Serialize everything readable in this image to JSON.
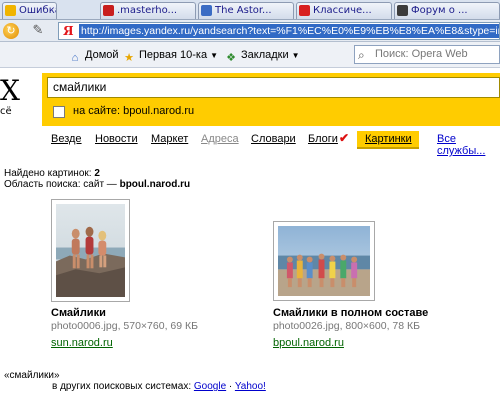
{
  "tabs": [
    {
      "label": "Ошибка",
      "icon": "warning-icon",
      "color": "#e8a600"
    },
    {
      "label": ".masterho...",
      "icon": "m-site-icon",
      "color": "#c81e1e"
    },
    {
      "label": "The Astor...",
      "icon": "page-icon",
      "color": "#3b6cc4"
    },
    {
      "label": "Классиче...",
      "icon": "star-site-icon",
      "color": "#d82020"
    },
    {
      "label": "Форум о ...",
      "icon": "forum-icon",
      "color": "#3c3c3c"
    }
  ],
  "address": {
    "logo": "Я",
    "url": "http://images.yandex.ru/yandsearch?text=%F1%EC%E0%E9%EB%E8%EA%E8&stype=image"
  },
  "bookmarks": [
    {
      "label": "Домой",
      "icon": "home-icon"
    },
    {
      "label": "Первая 10-ка",
      "icon": "star-icon",
      "has_dropdown": true
    },
    {
      "label": "Закладки",
      "icon": "bookmarks-icon",
      "has_dropdown": true
    }
  ],
  "opera_search": {
    "placeholder": "Поиск: Opera Web"
  },
  "logo": {
    "letter": "X",
    "sub": "сё"
  },
  "search": {
    "query": "смайлики",
    "site_label": "на сайте: bpoul.narod.ru"
  },
  "services": {
    "items": [
      "Везде",
      "Новости",
      "Маркет",
      "Адреса",
      "Словари",
      "Блоги"
    ],
    "active": "Картинки",
    "all": "Все службы..."
  },
  "results_info": {
    "found_label": "Найдено картинок:",
    "found_count": "2",
    "area_label": "Область поиска: сайт —",
    "area_site": "bpoul.narod.ru"
  },
  "results": [
    {
      "title": "Смайлики",
      "meta": "photo0006.jpg, 570×760, 69 КБ",
      "link": "sun.narod.ru"
    },
    {
      "title": "Смайлики в полном составе",
      "meta": "photo0026.jpg, 800×600, 78 КБ",
      "link": "bpoul.narod.ru"
    }
  ],
  "other_engines": {
    "query": "«смайлики»",
    "label": "в других поисковых системах:",
    "google": "Google",
    "sep": "·",
    "yahoo": "Yahoo!"
  },
  "colors": {
    "yandex_yellow": "#ffcc00",
    "link_green": "#006400",
    "link_blue": "#0000cc",
    "url_highlight": "#316ac5"
  }
}
